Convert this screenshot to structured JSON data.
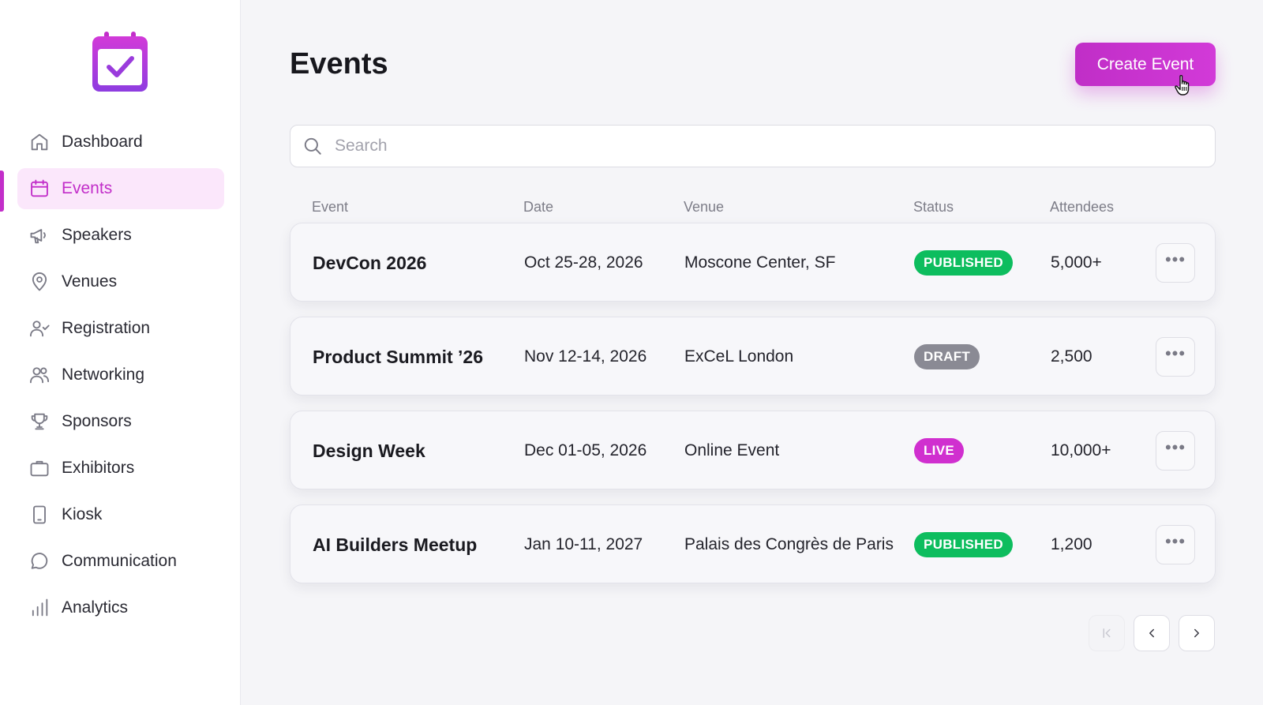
{
  "colors": {
    "accent": "#c22ec9",
    "published": "#0dbd5e",
    "draft": "#8a8a94",
    "live": "#d02fcf"
  },
  "sidebar": {
    "items": [
      {
        "label": "Dashboard",
        "icon": "home-icon",
        "active": false
      },
      {
        "label": "Events",
        "icon": "calendar-icon",
        "active": true
      },
      {
        "label": "Speakers",
        "icon": "megaphone-icon",
        "active": false
      },
      {
        "label": "Venues",
        "icon": "map-pin-icon",
        "active": false
      },
      {
        "label": "Registration",
        "icon": "user-check-icon",
        "active": false
      },
      {
        "label": "Networking",
        "icon": "users-icon",
        "active": false
      },
      {
        "label": "Sponsors",
        "icon": "trophy-icon",
        "active": false
      },
      {
        "label": "Exhibitors",
        "icon": "briefcase-icon",
        "active": false
      },
      {
        "label": "Kiosk",
        "icon": "tablet-icon",
        "active": false
      },
      {
        "label": "Communication",
        "icon": "chat-icon",
        "active": false
      },
      {
        "label": "Analytics",
        "icon": "bar-chart-icon",
        "active": false
      }
    ]
  },
  "header": {
    "title": "Events",
    "create_label": "Create Event"
  },
  "search": {
    "placeholder": "Search",
    "value": ""
  },
  "table": {
    "columns": [
      "Event",
      "Date",
      "Venue",
      "Status",
      "Attendees"
    ],
    "rows": [
      {
        "name": "DevCon 2026",
        "date": "Oct 25-28, 2026",
        "venue": "Moscone Center, SF",
        "status": "PUBLISHED",
        "attendees": "5,000+"
      },
      {
        "name": "Product Summit ’26",
        "date": "Nov 12-14, 2026",
        "venue": "ExCeL London",
        "status": "DRAFT",
        "attendees": "2,500"
      },
      {
        "name": "Design Week",
        "date": "Dec 01-05, 2026",
        "venue": "Online Event",
        "status": "LIVE",
        "attendees": "10,000+"
      },
      {
        "name": "AI Builders Meetup",
        "date": "Jan 10-11, 2027",
        "venue": "Palais des Congrès de Paris",
        "status": "PUBLISHED",
        "attendees": "1,200"
      }
    ],
    "more_label": "•••"
  }
}
